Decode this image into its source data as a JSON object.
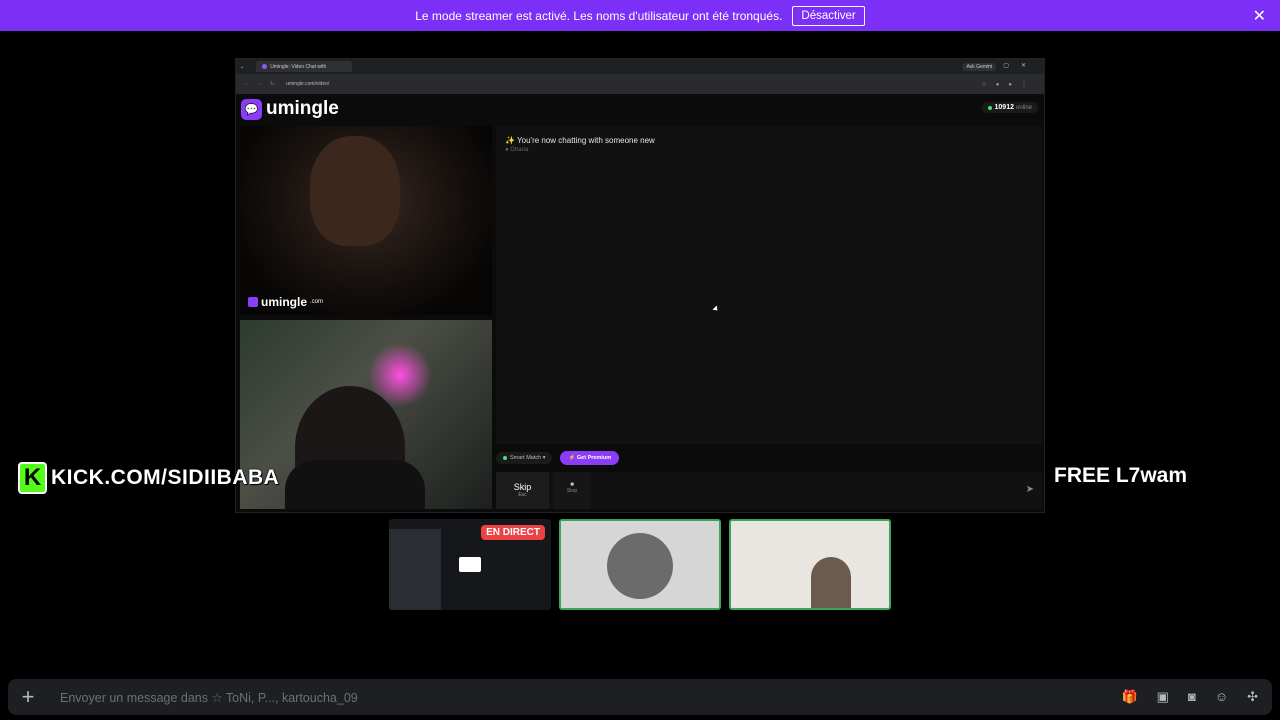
{
  "banner": {
    "text": "Le mode streamer est activé. Les noms d'utilisateur ont été tronqués.",
    "button": "Désactiver",
    "close": "✕"
  },
  "browser": {
    "tab_title": "Umingle: Video Chat with",
    "gemini": "Ask Gemini",
    "url": "umingle.com/video/"
  },
  "app": {
    "logo_text": "umingle",
    "online_count": "10912",
    "online_label": "online",
    "watermark": "umingle",
    "watermark_suffix": ".com",
    "chat_message": "You're now chatting with someone new",
    "chat_country": "Ghana",
    "smart_match": "Smart Match",
    "get_premium": "Get Premium",
    "skip_label": "Skip",
    "skip_key": "Esc",
    "stop_label": "Stop"
  },
  "overlay": {
    "kick_text": "KICK.COM/SIDIIBABA",
    "kick_logo": "K",
    "free_text": "FREE L7wam"
  },
  "thumbnails": {
    "live_badge": "EN DIRECT"
  },
  "message_bar": {
    "placeholder": "Envoyer un message dans ☆ ToNi, P..., kartoucha_09",
    "plus": "+"
  },
  "icons": [
    "plus-icon",
    "gift-icon",
    "gif-icon",
    "sticker-icon",
    "emoji-icon",
    "apps-icon"
  ]
}
